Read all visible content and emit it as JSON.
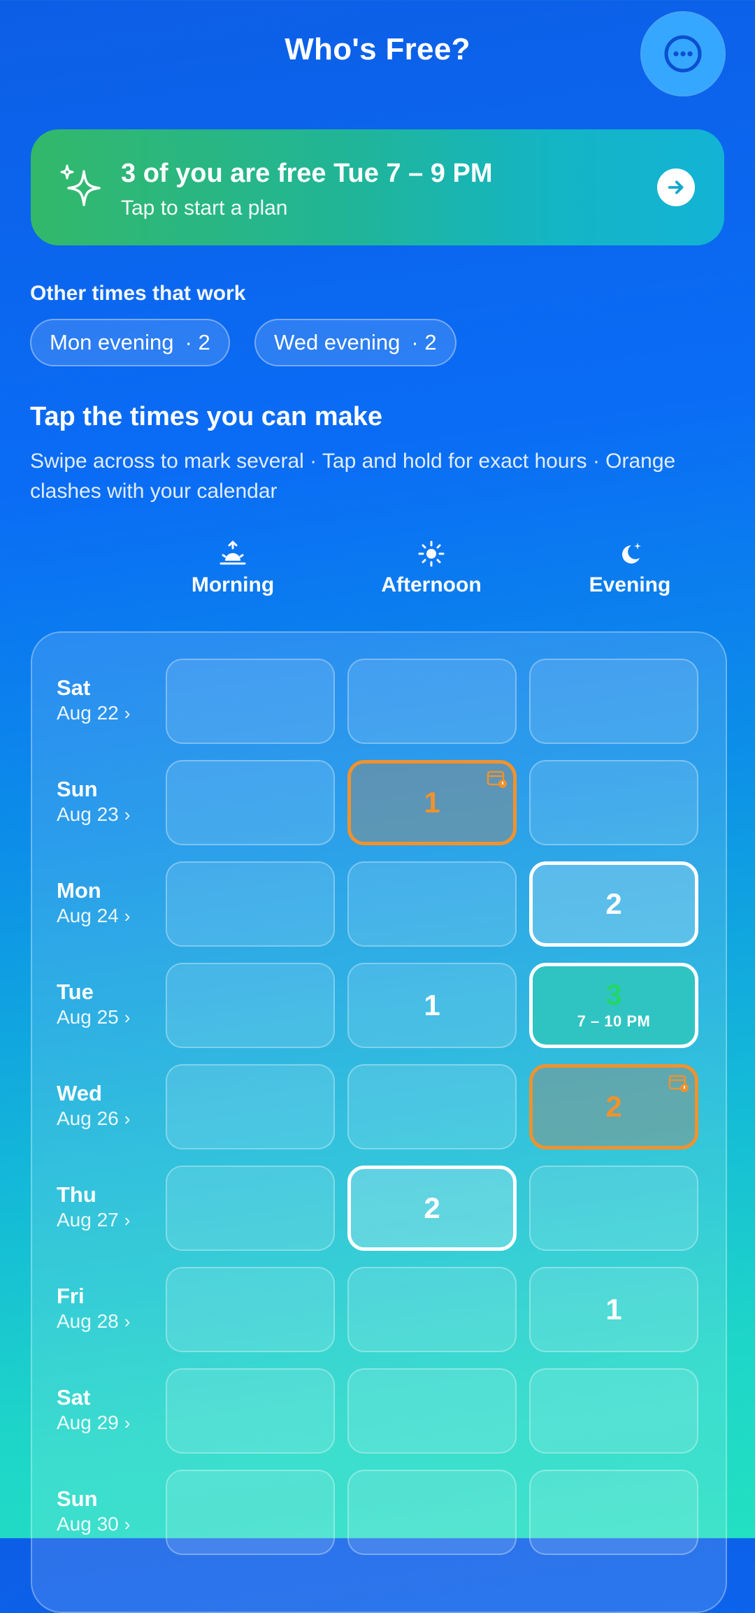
{
  "header": {
    "title": "Who's Free?",
    "menu_icon": "more-icon"
  },
  "banner": {
    "title": "3 of you are free Tue 7 – 9 PM",
    "subtitle": "Tap to start a plan",
    "icon": "sparkle-icon",
    "action_icon": "arrow-right-icon"
  },
  "other_times": {
    "label": "Other times that work",
    "chips": [
      {
        "label": "Mon evening",
        "count": "· 2"
      },
      {
        "label": "Wed evening",
        "count": "· 2"
      }
    ]
  },
  "section": {
    "title": "Tap the times you can make",
    "hint": "Swipe across to mark several · Tap and hold for exact hours · Orange clashes with your calendar"
  },
  "slots": [
    {
      "label": "Morning",
      "icon": "sunrise-icon"
    },
    {
      "label": "Afternoon",
      "icon": "sun-icon"
    },
    {
      "label": "Evening",
      "icon": "moon-icon"
    }
  ],
  "days": [
    {
      "day": "Sat",
      "date": "Aug 22",
      "cells": [
        {
          "count": ""
        },
        {
          "count": ""
        },
        {
          "count": ""
        }
      ]
    },
    {
      "day": "Sun",
      "date": "Aug 23",
      "cells": [
        {
          "count": ""
        },
        {
          "count": "1",
          "state": "conflict"
        },
        {
          "count": ""
        }
      ]
    },
    {
      "day": "Mon",
      "date": "Aug 24",
      "cells": [
        {
          "count": ""
        },
        {
          "count": ""
        },
        {
          "count": "2",
          "state": "selected"
        }
      ]
    },
    {
      "day": "Tue",
      "date": "Aug 25",
      "cells": [
        {
          "count": ""
        },
        {
          "count": "1"
        },
        {
          "count": "3",
          "state": "best",
          "time": "7 – 10 PM"
        }
      ]
    },
    {
      "day": "Wed",
      "date": "Aug 26",
      "cells": [
        {
          "count": ""
        },
        {
          "count": ""
        },
        {
          "count": "2",
          "state": "conflict"
        }
      ]
    },
    {
      "day": "Thu",
      "date": "Aug 27",
      "cells": [
        {
          "count": ""
        },
        {
          "count": "2",
          "state": "selected"
        },
        {
          "count": ""
        }
      ]
    },
    {
      "day": "Fri",
      "date": "Aug 28",
      "cells": [
        {
          "count": ""
        },
        {
          "count": ""
        },
        {
          "count": "1"
        }
      ]
    },
    {
      "day": "Sat",
      "date": "Aug 29",
      "cells": [
        {
          "count": ""
        },
        {
          "count": ""
        },
        {
          "count": ""
        }
      ]
    },
    {
      "day": "Sun",
      "date": "Aug 30",
      "cells": [
        {
          "count": ""
        },
        {
          "count": ""
        },
        {
          "count": ""
        }
      ]
    }
  ],
  "colors": {
    "conflict": "#f0922e",
    "best_count": "#23d66a",
    "banner_start": "#33b86a",
    "banner_end": "#13b3d6"
  }
}
